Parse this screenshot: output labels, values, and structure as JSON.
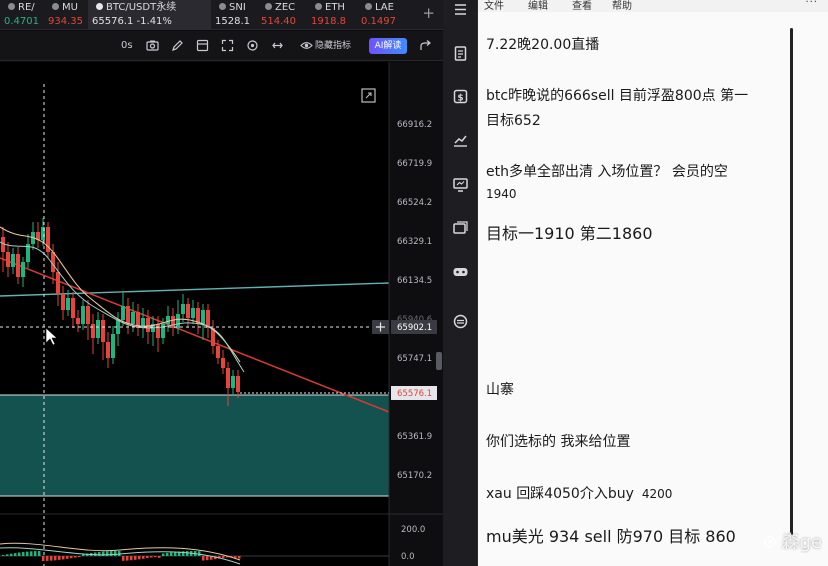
{
  "tabs": [
    {
      "name": "RE/",
      "price": "0.4701",
      "color": "green",
      "width": 44
    },
    {
      "name": "MU",
      "price": "934.35",
      "color": "red",
      "width": 44
    },
    {
      "name": "BTC/USDT永续",
      "price": "65576.1",
      "change": "-1.41%",
      "color": "white",
      "width": 123,
      "active": true
    },
    {
      "name": "SNI",
      "price": "1528.1",
      "color": "white",
      "width": 46
    },
    {
      "name": "ZEC",
      "price": "514.40",
      "color": "red",
      "width": 50
    },
    {
      "name": "ETH",
      "price": "1918.8",
      "color": "red",
      "width": 50
    },
    {
      "name": "LAE",
      "price": "0.1497",
      "color": "red",
      "width": 50
    }
  ],
  "tab_add": "+",
  "toolbar": {
    "interval": "0s",
    "hide_label": "隐藏指标",
    "ai_label": "AI解读"
  },
  "price_axis": {
    "ticks": [
      "66916.2",
      "66719.9",
      "66524.2",
      "66329.1",
      "66134.5",
      "65747.1",
      "65361.9",
      "65170.2"
    ],
    "crosshair_label": "65902.1",
    "last_label": "65576.1",
    "partial_label": "65940.6"
  },
  "indicator_axis": {
    "ticks": [
      "200.0",
      "0.0"
    ]
  },
  "notepad": {
    "menu": [
      "文件",
      "编辑",
      "查看",
      "帮助"
    ],
    "more": "···",
    "lines": [
      {
        "text": "7.22晚20.00直播"
      },
      {
        "text": "btc昨晚说的666sell   目前浮盈800点   第一"
      },
      {
        "text": "目标652"
      },
      {
        "text": "eth多单全部出清    入场位置？   会员的空"
      },
      {
        "text": "1940"
      },
      {
        "text": "目标一1910   第二1860"
      },
      {
        "text": "山寨"
      },
      {
        "text": "你们选标的 我来给位置"
      },
      {
        "text": "xau   回踩4050介入buy"
      },
      {
        "text": "4200"
      },
      {
        "text": "mu美光    934    sell     防970    目标    860"
      }
    ]
  },
  "watermark": "森ge",
  "colors": {
    "up": "#1fb57e",
    "down": "#e5453a",
    "zone": "#14524f",
    "trendline": "#d93a30",
    "channel": "#5fb3b0"
  }
}
